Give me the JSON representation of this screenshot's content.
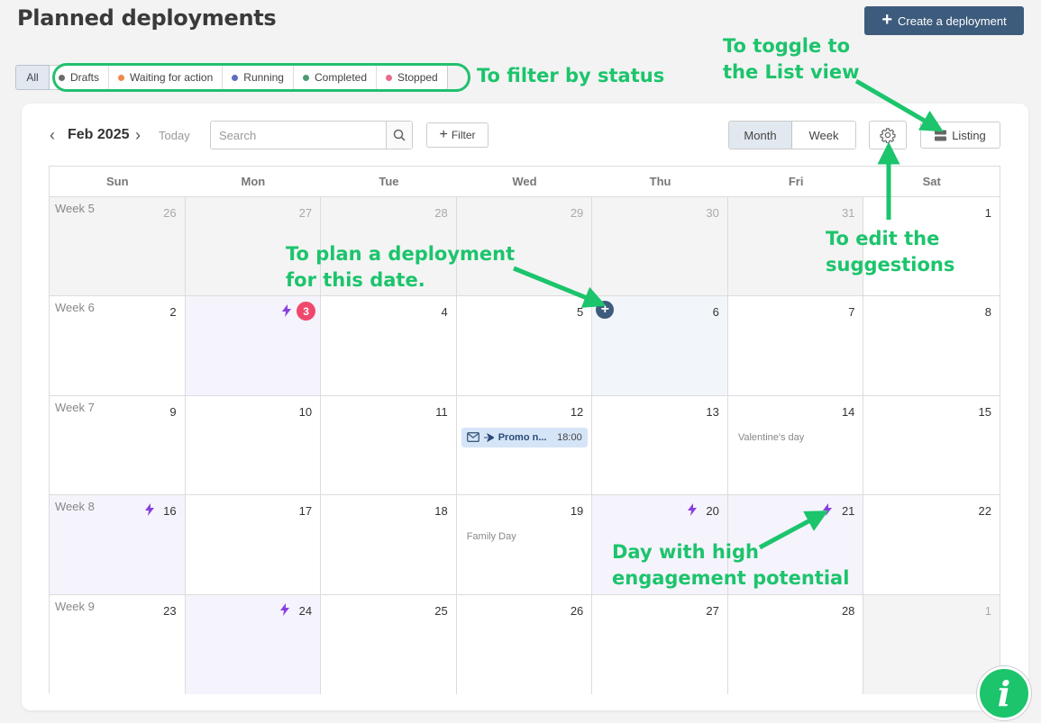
{
  "header": {
    "title": "Planned deployments",
    "create_label": "Create a deployment"
  },
  "status_filter": {
    "all_label": "All",
    "items": [
      {
        "label": "Drafts",
        "color": "#6b6b6b"
      },
      {
        "label": "Waiting for action",
        "color": "#f0894a"
      },
      {
        "label": "Running",
        "color": "#5b6fbf"
      },
      {
        "label": "Completed",
        "color": "#4e9a72"
      },
      {
        "label": "Stopped",
        "color": "#e86b8e"
      }
    ]
  },
  "toolbar": {
    "month_label": "Feb 2025",
    "today_label": "Today",
    "search_placeholder": "Search",
    "filter_label": "Filter",
    "month_view_label": "Month",
    "week_view_label": "Week",
    "listing_label": "Listing"
  },
  "calendar": {
    "days_of_week": [
      "Sun",
      "Mon",
      "Tue",
      "Wed",
      "Thu",
      "Fri",
      "Sat"
    ],
    "weeks": [
      {
        "label": "Week 5",
        "days": [
          {
            "num": "26",
            "out": true
          },
          {
            "num": "27",
            "out": true
          },
          {
            "num": "28",
            "out": true
          },
          {
            "num": "29",
            "out": true
          },
          {
            "num": "30",
            "out": true
          },
          {
            "num": "31",
            "out": true
          },
          {
            "num": "1"
          }
        ]
      },
      {
        "label": "Week 6",
        "days": [
          {
            "num": "2"
          },
          {
            "num": "3",
            "high": true,
            "badge": "3"
          },
          {
            "num": "4"
          },
          {
            "num": "5"
          },
          {
            "num": "6",
            "today": true,
            "add": true
          },
          {
            "num": "7"
          },
          {
            "num": "8"
          }
        ]
      },
      {
        "label": "Week 7",
        "days": [
          {
            "num": "9"
          },
          {
            "num": "10"
          },
          {
            "num": "11"
          },
          {
            "num": "12",
            "event": {
              "title": "Promo n...",
              "time": "18:00"
            }
          },
          {
            "num": "13"
          },
          {
            "num": "14",
            "holiday": "Valentine's day"
          },
          {
            "num": "15"
          }
        ]
      },
      {
        "label": "Week 8",
        "days": [
          {
            "num": "16",
            "high": true
          },
          {
            "num": "17"
          },
          {
            "num": "18"
          },
          {
            "num": "19",
            "holiday": "Family Day"
          },
          {
            "num": "20",
            "high": true
          },
          {
            "num": "21",
            "high": true
          },
          {
            "num": "22"
          }
        ]
      },
      {
        "label": "Week 9",
        "days": [
          {
            "num": "23"
          },
          {
            "num": "24",
            "high": true
          },
          {
            "num": "25"
          },
          {
            "num": "26"
          },
          {
            "num": "27"
          },
          {
            "num": "28"
          },
          {
            "num": "1",
            "out": true
          }
        ]
      }
    ]
  },
  "annotations": {
    "filter_status": "To filter by status",
    "toggle_list_1": "To toggle to",
    "toggle_list_2": "the List view",
    "edit_suggestions_1": "To edit the",
    "edit_suggestions_2": "suggestions",
    "plan_deployment_1": "To plan a deployment",
    "plan_deployment_2": "for this date.",
    "high_engagement_1": "Day with high",
    "high_engagement_2": "engagement potential"
  },
  "info_badge_label": "i",
  "colors": {
    "accent": "#3d5b7c",
    "annotation": "#1cc46c",
    "bolt": "#8a3fe0",
    "badge": "#f0486c"
  }
}
